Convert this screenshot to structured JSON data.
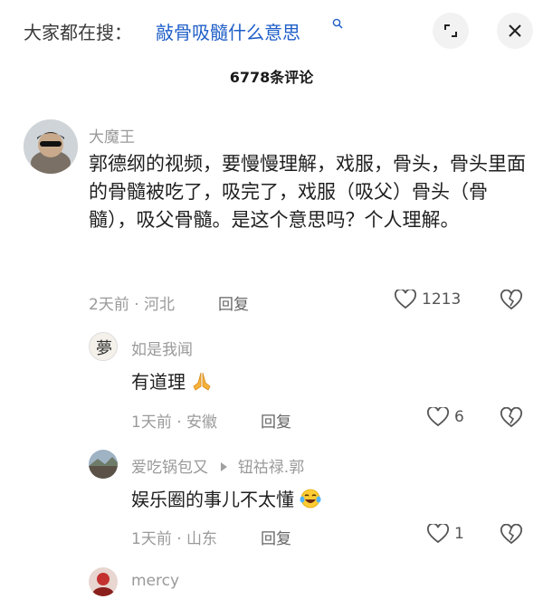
{
  "search": {
    "prefix": "大家都在搜：",
    "query": "敲骨吸髓什么意思"
  },
  "comments_count": "6778条评论",
  "comments": [
    {
      "username": "大魔王",
      "text": "郭德纲的视频，要慢慢理解，戏服，骨头，骨头里面的骨髓被吃了，吸完了，戏服（吸父）骨头（骨髓），吸父骨髓。是这个意思吗？个人理解。",
      "time": "2天前",
      "location": "河北",
      "reply_label": "回复",
      "likes": "1213"
    }
  ],
  "replies": [
    {
      "username": "如是我闻",
      "text": "有道理",
      "time": "1天前",
      "location": "安徽",
      "reply_label": "回复",
      "likes": "6",
      "emoji": "praying-hands"
    },
    {
      "username": "爱吃锅包又",
      "reply_to": "钮祜禄.郭",
      "text": "娱乐圈的事儿不太懂",
      "time": "1天前",
      "location": "山东",
      "reply_label": "回复",
      "likes": "1",
      "emoji": "laughing-tears"
    },
    {
      "username": "mercy"
    }
  ],
  "separator": "·"
}
